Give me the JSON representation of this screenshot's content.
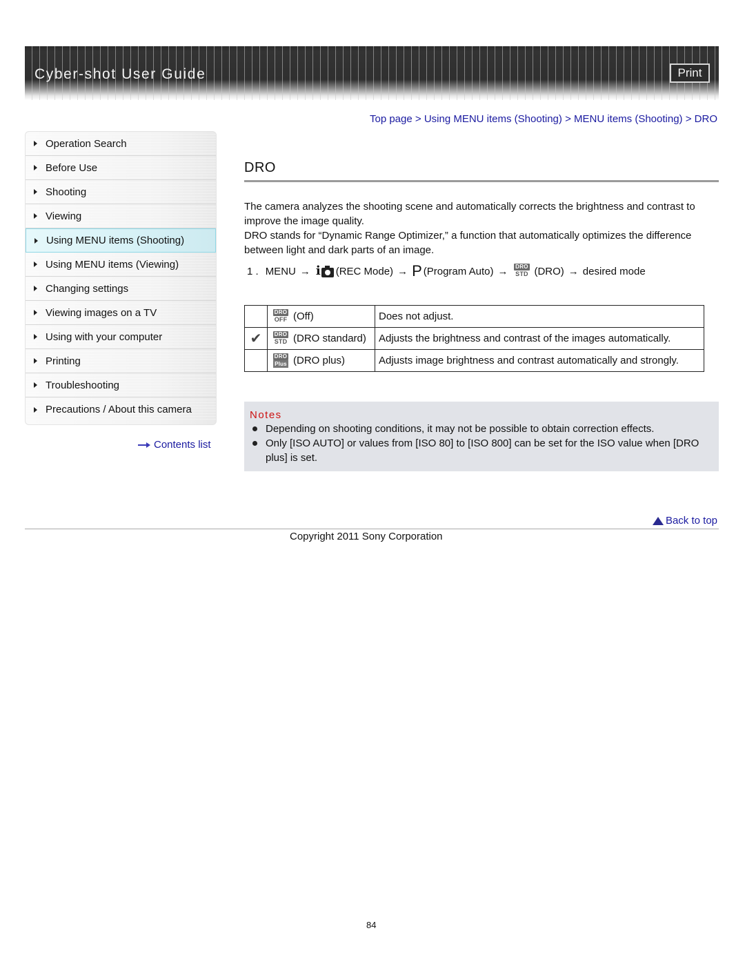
{
  "header": {
    "title": "Cyber-shot User Guide",
    "print_label": "Print"
  },
  "sidebar": {
    "items": [
      {
        "label": "Operation Search",
        "active": false
      },
      {
        "label": "Before Use",
        "active": false
      },
      {
        "label": "Shooting",
        "active": false
      },
      {
        "label": "Viewing",
        "active": false
      },
      {
        "label": "Using MENU items (Shooting)",
        "active": true
      },
      {
        "label": "Using MENU items (Viewing)",
        "active": false
      },
      {
        "label": "Changing settings",
        "active": false
      },
      {
        "label": "Viewing images on a TV",
        "active": false
      },
      {
        "label": "Using with your computer",
        "active": false
      },
      {
        "label": "Printing",
        "active": false
      },
      {
        "label": "Troubleshooting",
        "active": false
      },
      {
        "label": "Precautions / About this camera",
        "active": false
      }
    ],
    "contents_link": "Contents list"
  },
  "breadcrumb": {
    "items": [
      "Top page",
      "Using MENU items (Shooting)",
      "MENU items (Shooting)",
      "DRO"
    ],
    "separator": ">"
  },
  "main": {
    "title": "DRO",
    "paragraphs": [
      "The camera analyzes the shooting scene and automatically corrects the brightness and contrast to improve the image quality.",
      "DRO stands for “Dynamic Range Optimizer,” a function that automatically optimizes the difference between light and dark parts of an image."
    ],
    "step": {
      "number": "1 .",
      "menu": "MENU",
      "arrow": "→",
      "rec_mode_icon": "i-camera-icon",
      "rec_mode": "(REC Mode)",
      "program_icon_letter": "P",
      "program": "(Program Auto)",
      "dro_icon": "dro-std-icon",
      "dro": "(DRO)",
      "desired": "desired mode"
    },
    "modes": [
      {
        "selected": false,
        "icon": {
          "top": "DRO",
          "bottom": "OFF"
        },
        "name": "(Off)",
        "description": "Does not adjust."
      },
      {
        "selected": true,
        "icon": {
          "top": "DRO",
          "bottom": "STD"
        },
        "name": "(DRO standard)",
        "description": "Adjusts the brightness and contrast of the images automatically."
      },
      {
        "selected": false,
        "icon": {
          "top": "DRO",
          "bottom": "Plus"
        },
        "name": "(DRO plus)",
        "description": "Adjusts image brightness and contrast automatically and strongly."
      }
    ],
    "check_glyph": "✔",
    "notes": {
      "title": "Notes",
      "items": [
        "Depending on shooting conditions, it may not be possible to obtain correction effects.",
        "Only [ISO AUTO] or values from [ISO 80] to [ISO 800] can be set for the ISO value when [DRO plus] is set."
      ]
    }
  },
  "footer": {
    "back_to_top": "Back to top",
    "copyright": "Copyright 2011 Sony Corporation",
    "page_number": "84"
  },
  "colors": {
    "link": "#1a1aa0",
    "notes_title": "#cc1111",
    "notes_bg": "#e1e3e8",
    "active_nav_bg": "#d6f1f6",
    "active_nav_border": "#8fd8e6"
  }
}
